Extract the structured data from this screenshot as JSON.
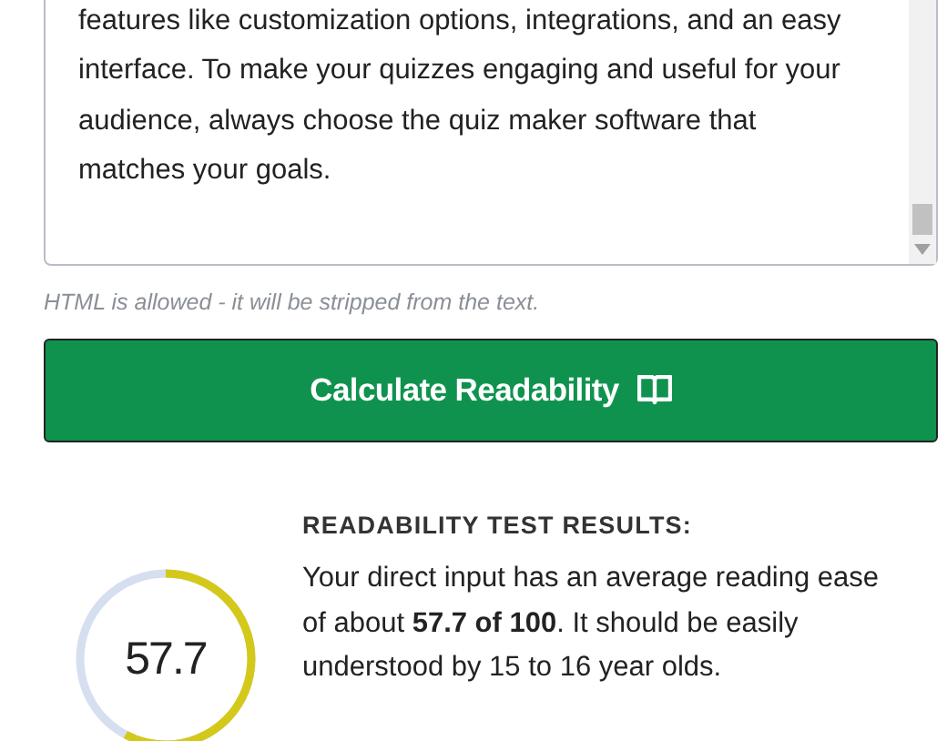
{
  "text_input": {
    "value": "features like customization options, integrations, and an easy interface. To make your quizzes engaging and useful for your audience, always choose the quiz maker software that matches your goals.",
    "hint": "HTML is allowed - it will be stripped from the text."
  },
  "calculate_button": {
    "label": "Calculate Readability"
  },
  "results": {
    "heading": "READABILITY TEST RESULTS:",
    "score": "57.7",
    "level": 0.577,
    "summary": "Your direct input has an average reading ease of about **57.7 of 100**. It should be easily understood by 15 to 16 year olds."
  }
}
